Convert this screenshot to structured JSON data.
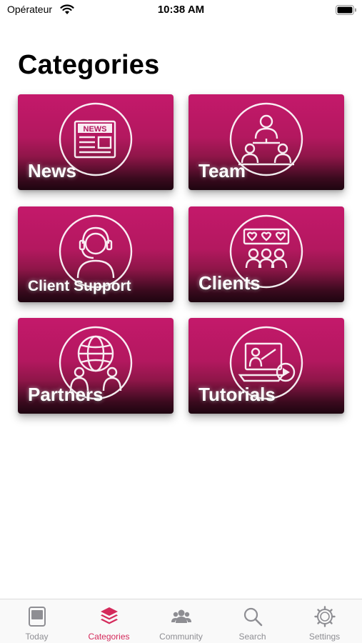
{
  "status_bar": {
    "carrier": "Opérateur",
    "time": "10:38 AM",
    "icons": [
      "wifi-icon",
      "battery-icon"
    ]
  },
  "page": {
    "title": "Categories"
  },
  "categories": [
    {
      "label": "News",
      "icon": "newspaper-icon"
    },
    {
      "label": "Team",
      "icon": "team-icon"
    },
    {
      "label": "Client Support",
      "icon": "headset-agent-icon"
    },
    {
      "label": "Clients",
      "icon": "clients-hearts-icon"
    },
    {
      "label": "Partners",
      "icon": "globe-partners-icon"
    },
    {
      "label": "Tutorials",
      "icon": "video-tutorial-icon"
    }
  ],
  "news_art_text": "NEWS",
  "tab_bar": {
    "tabs": [
      {
        "label": "Today",
        "icon": "today-icon",
        "active": false
      },
      {
        "label": "Categories",
        "icon": "layers-icon",
        "active": true
      },
      {
        "label": "Community",
        "icon": "community-icon",
        "active": false
      },
      {
        "label": "Search",
        "icon": "search-icon",
        "active": false
      },
      {
        "label": "Settings",
        "icon": "gear-icon",
        "active": false
      }
    ]
  },
  "colors": {
    "card_top": "#c4196b",
    "card_bottom": "#1e0510",
    "tab_active": "#d42a5b",
    "tab_inactive": "#8e8e93"
  }
}
